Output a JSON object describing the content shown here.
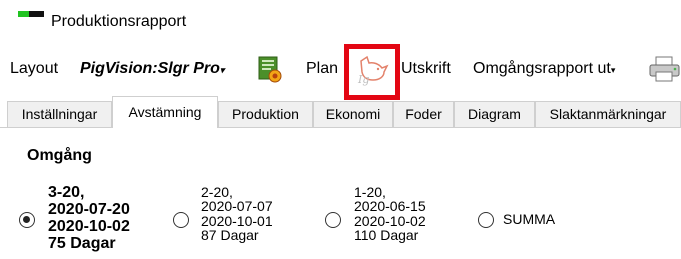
{
  "window": {
    "title": "Produktionsrapport"
  },
  "toolbar": {
    "layout_label": "Layout",
    "layout_value": "PigVision:Slgr Pro",
    "plan_label": "Plan",
    "print_label": "Utskrift",
    "print_value": "Omgångsrapport ut"
  },
  "tabs": [
    {
      "label": "Inställningar",
      "active": false
    },
    {
      "label": "Avstämning",
      "active": true
    },
    {
      "label": "Produktion",
      "active": false
    },
    {
      "label": "Ekonomi",
      "active": false
    },
    {
      "label": "Foder",
      "active": false
    },
    {
      "label": "Diagram",
      "active": false
    },
    {
      "label": "Slaktanmärkningar",
      "active": false
    }
  ],
  "section": {
    "title": "Omgång"
  },
  "rounds": [
    {
      "name": "3-20,",
      "start": "2020-07-20",
      "end": "2020-10-02",
      "duration": "75 Dagar",
      "selected": true
    },
    {
      "name": "2-20,",
      "start": "2020-07-07",
      "end": "2020-10-01",
      "duration": "87 Dagar",
      "selected": false
    },
    {
      "name": "1-20,",
      "start": "2020-06-15",
      "end": "2020-10-02",
      "duration": "110 Dagar",
      "selected": false
    }
  ],
  "summary_option": {
    "label": "SUMMA",
    "selected": false
  },
  "icons": [
    "report-icon",
    "pig-icon",
    "printer-icon"
  ],
  "colors": {
    "highlight": "#e30613",
    "logo_green": "#21c321"
  }
}
